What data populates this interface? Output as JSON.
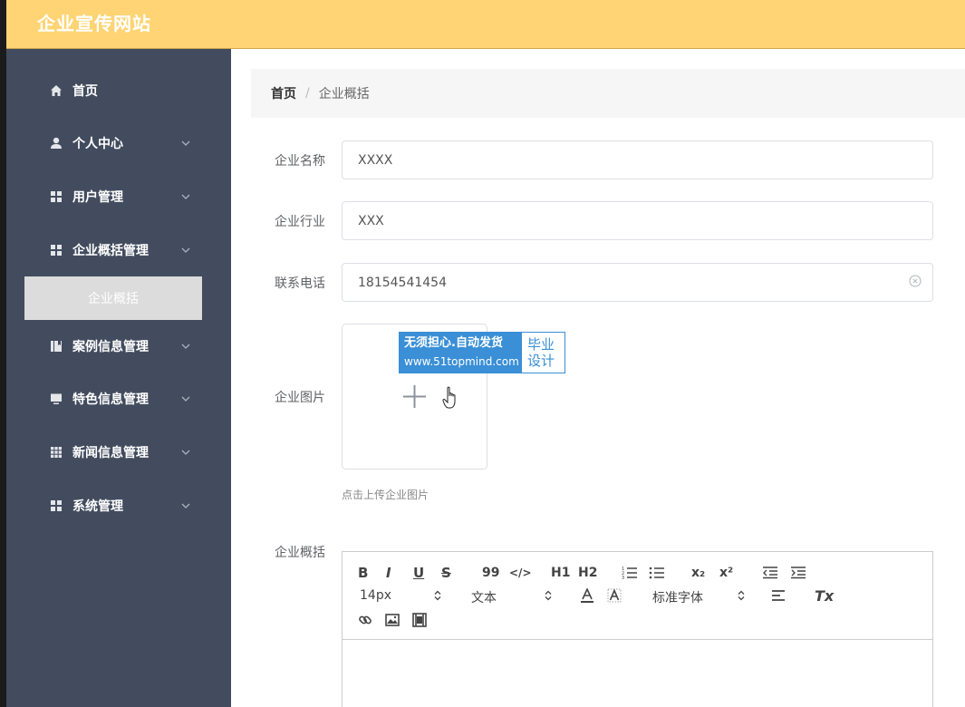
{
  "header": {
    "site_title": "企业宣传网站"
  },
  "sidebar": {
    "items": [
      {
        "label": "首页",
        "icon": "home-icon"
      },
      {
        "label": "个人中心",
        "icon": "user-icon"
      },
      {
        "label": "用户管理",
        "icon": "grid-icon"
      },
      {
        "label": "企业概括管理",
        "icon": "grid-icon"
      },
      {
        "label": "案例信息管理",
        "icon": "book-icon"
      },
      {
        "label": "特色信息管理",
        "icon": "monitor-icon"
      },
      {
        "label": "新闻信息管理",
        "icon": "table-icon"
      },
      {
        "label": "系统管理",
        "icon": "grid-icon"
      }
    ],
    "active_subitem": "企业概括"
  },
  "breadcrumb": {
    "home": "首页",
    "separator": "/",
    "current": "企业概括"
  },
  "form": {
    "name_label": "企业名称",
    "name_value": "XXXX",
    "industry_label": "企业行业",
    "industry_value": "XXX",
    "phone_label": "联系电话",
    "phone_value": "18154541454",
    "image_label": "企业图片",
    "image_hint": "点击上传企业图片",
    "overview_label": "企业概括"
  },
  "watermark": {
    "line1": "无须担心.自动发货",
    "line2": "www.51topmind.com",
    "right_line1": "毕业",
    "right_line2": "设计"
  },
  "editor": {
    "bold": "B",
    "italic": "I",
    "underline": "U",
    "strike": "S",
    "quote": "99",
    "code": "</>",
    "h1": "H1",
    "h2": "H2",
    "sub": "x₂",
    "sup": "x²",
    "font_size": "14px",
    "text_type": "文本",
    "font_family": "标准字体",
    "clear": "Tx"
  },
  "colors": {
    "topbar": "#fed474",
    "sidebar": "#424c5e",
    "active_sub": "#dcdcdc"
  }
}
